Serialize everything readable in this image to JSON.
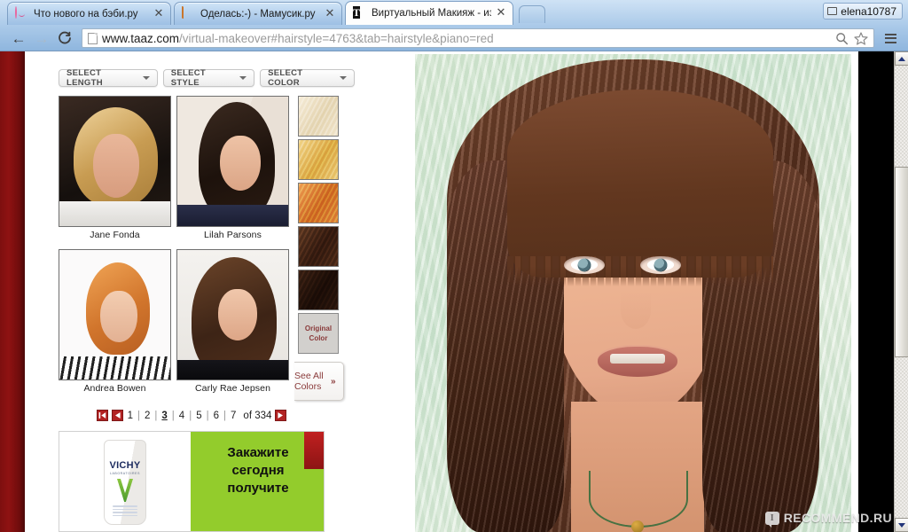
{
  "browser": {
    "tabs": [
      {
        "title": "Что нового на бэби.ру",
        "favicon": "baby-face-icon",
        "active": false,
        "close_label": "✕"
      },
      {
        "title": "Оделась:-) - Мамусик.ру",
        "favicon": "dress-icon",
        "active": false,
        "close_label": "✕"
      },
      {
        "title": "Виртуальный Макияж - изм",
        "favicon": "taaz-t-icon",
        "active": true,
        "close_label": "✕"
      }
    ],
    "user_chip": {
      "label": "elena10787",
      "icon": "user-account-icon"
    },
    "toolbar": {
      "back_label": "←",
      "forward_label": "→",
      "reload_label": "C",
      "url_domain": "www.taaz.com",
      "url_path": "/virtual-makeover#hairstyle=4763&tab=hairstyle&piano=red",
      "url_full": "www.taaz.com/virtual-makeover#hairstyle=4763&tab=hairstyle&piano=red",
      "search_icon": "search-icon",
      "bookmark_icon": "star-icon",
      "menu_icon": "hamburger-menu-icon"
    }
  },
  "page": {
    "filters": [
      {
        "label": "SELECT LENGTH"
      },
      {
        "label": "SELECT STYLE"
      },
      {
        "label": "SELECT COLOR"
      }
    ],
    "hairstyles": [
      {
        "name": "Jane Fonda"
      },
      {
        "name": "Lilah Parsons"
      },
      {
        "name": "Andrea Bowen"
      },
      {
        "name": "Carly Rae Jepsen"
      }
    ],
    "colors": {
      "swatches": [
        {
          "name": "pale-blonde",
          "hex": "#efe4cd"
        },
        {
          "name": "golden-blonde",
          "hex": "#e2b45f"
        },
        {
          "name": "copper-red",
          "hex": "#d4742c"
        },
        {
          "name": "medium-brown",
          "hex": "#4a2a18"
        },
        {
          "name": "dark-brown",
          "hex": "#2a160c"
        }
      ],
      "original_label_line1": "Original",
      "original_label_line2": "Color",
      "see_all_line1": "See All",
      "see_all_line2": "Colors",
      "see_all_arrows": "»"
    },
    "pagination": {
      "first_label": "❙◀",
      "prev_label": "◀",
      "pages": [
        "1",
        "2",
        "3",
        "4",
        "5",
        "6",
        "7"
      ],
      "current_page": "3",
      "separator": "|",
      "total_label": "of 334",
      "next_label": "▶"
    },
    "ad": {
      "brand": "VICHY",
      "brand_sub": "LABORATOIRES",
      "text_line1": "Закажите",
      "text_line2": "сегодня",
      "text_line3": "получите",
      "adchoices_icon": "adchoices-icon",
      "bg_color": "#93cc2c"
    },
    "preview": {
      "alt": "virtual-makeover-result-photo",
      "hair_color": "#5d3320",
      "background_color": "#d4e8d4"
    },
    "watermark": {
      "badge": "I",
      "text": "RECOMMEND.RU"
    }
  },
  "scrollbar": {
    "up_label": "▲",
    "down_label": "▼"
  }
}
